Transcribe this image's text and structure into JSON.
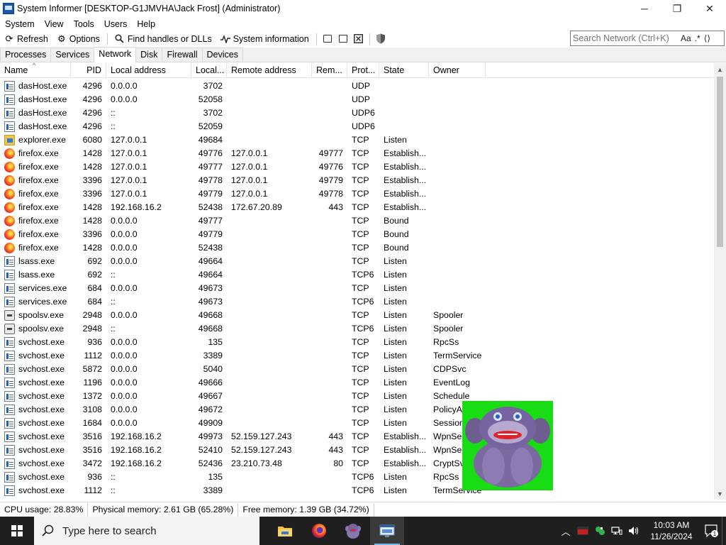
{
  "window": {
    "title": "System Informer [DESKTOP-G1JMVHA\\Jack Frost] (Administrator)",
    "minimize_glyph": "─",
    "maximize_glyph": "❐",
    "close_glyph": "✕"
  },
  "menu": [
    "System",
    "View",
    "Tools",
    "Users",
    "Help"
  ],
  "toolbar": {
    "refresh_label": "Refresh",
    "options_label": "Options",
    "find_label": "Find handles or DLLs",
    "sysinfo_label": "System information"
  },
  "search": {
    "placeholder": "Search Network (Ctrl+K)",
    "case_label": "Aa",
    "regex_label": ".*"
  },
  "tabs": [
    "Processes",
    "Services",
    "Network",
    "Disk",
    "Firewall",
    "Devices"
  ],
  "active_tab": "Network",
  "columns": [
    "Name",
    "PID",
    "Local address",
    "Local...",
    "Remote address",
    "Rem...",
    "Prot...",
    "State",
    "Owner"
  ],
  "rows": [
    {
      "icon": "host-icon",
      "name": "dasHost.exe",
      "pid": "4296",
      "laddr": "0.0.0.0",
      "lport": "3702",
      "raddr": "",
      "rport": "",
      "proto": "UDP",
      "state": "",
      "owner": ""
    },
    {
      "icon": "host-icon",
      "name": "dasHost.exe",
      "pid": "4296",
      "laddr": "0.0.0.0",
      "lport": "52058",
      "raddr": "",
      "rport": "",
      "proto": "UDP",
      "state": "",
      "owner": ""
    },
    {
      "icon": "host-icon",
      "name": "dasHost.exe",
      "pid": "4296",
      "laddr": "::",
      "lport": "3702",
      "raddr": "",
      "rport": "",
      "proto": "UDP6",
      "state": "",
      "owner": ""
    },
    {
      "icon": "host-icon",
      "name": "dasHost.exe",
      "pid": "4296",
      "laddr": "::",
      "lport": "52059",
      "raddr": "",
      "rport": "",
      "proto": "UDP6",
      "state": "",
      "owner": ""
    },
    {
      "icon": "explorer-icon",
      "name": "explorer.exe",
      "pid": "6080",
      "laddr": "127.0.0.1",
      "lport": "49684",
      "raddr": "",
      "rport": "",
      "proto": "TCP",
      "state": "Listen",
      "owner": ""
    },
    {
      "icon": "firefox-icon",
      "name": "firefox.exe",
      "pid": "1428",
      "laddr": "127.0.0.1",
      "lport": "49776",
      "raddr": "127.0.0.1",
      "rport": "49777",
      "proto": "TCP",
      "state": "Establish...",
      "owner": ""
    },
    {
      "icon": "firefox-icon",
      "name": "firefox.exe",
      "pid": "1428",
      "laddr": "127.0.0.1",
      "lport": "49777",
      "raddr": "127.0.0.1",
      "rport": "49776",
      "proto": "TCP",
      "state": "Establish...",
      "owner": ""
    },
    {
      "icon": "firefox-icon",
      "name": "firefox.exe",
      "pid": "3396",
      "laddr": "127.0.0.1",
      "lport": "49778",
      "raddr": "127.0.0.1",
      "rport": "49779",
      "proto": "TCP",
      "state": "Establish...",
      "owner": ""
    },
    {
      "icon": "firefox-icon",
      "name": "firefox.exe",
      "pid": "3396",
      "laddr": "127.0.0.1",
      "lport": "49779",
      "raddr": "127.0.0.1",
      "rport": "49778",
      "proto": "TCP",
      "state": "Establish...",
      "owner": ""
    },
    {
      "icon": "firefox-icon",
      "name": "firefox.exe",
      "pid": "1428",
      "laddr": "192.168.16.2",
      "lport": "52438",
      "raddr": "172.67.20.89",
      "rport": "443",
      "proto": "TCP",
      "state": "Establish...",
      "owner": ""
    },
    {
      "icon": "firefox-icon",
      "name": "firefox.exe",
      "pid": "1428",
      "laddr": "0.0.0.0",
      "lport": "49777",
      "raddr": "",
      "rport": "",
      "proto": "TCP",
      "state": "Bound",
      "owner": ""
    },
    {
      "icon": "firefox-icon",
      "name": "firefox.exe",
      "pid": "3396",
      "laddr": "0.0.0.0",
      "lport": "49779",
      "raddr": "",
      "rport": "",
      "proto": "TCP",
      "state": "Bound",
      "owner": ""
    },
    {
      "icon": "firefox-icon",
      "name": "firefox.exe",
      "pid": "1428",
      "laddr": "0.0.0.0",
      "lport": "52438",
      "raddr": "",
      "rport": "",
      "proto": "TCP",
      "state": "Bound",
      "owner": ""
    },
    {
      "icon": "host-icon",
      "name": "lsass.exe",
      "pid": "692",
      "laddr": "0.0.0.0",
      "lport": "49664",
      "raddr": "",
      "rport": "",
      "proto": "TCP",
      "state": "Listen",
      "owner": ""
    },
    {
      "icon": "host-icon",
      "name": "lsass.exe",
      "pid": "692",
      "laddr": "::",
      "lport": "49664",
      "raddr": "",
      "rport": "",
      "proto": "TCP6",
      "state": "Listen",
      "owner": ""
    },
    {
      "icon": "host-icon",
      "name": "services.exe",
      "pid": "684",
      "laddr": "0.0.0.0",
      "lport": "49673",
      "raddr": "",
      "rport": "",
      "proto": "TCP",
      "state": "Listen",
      "owner": ""
    },
    {
      "icon": "host-icon",
      "name": "services.exe",
      "pid": "684",
      "laddr": "::",
      "lport": "49673",
      "raddr": "",
      "rport": "",
      "proto": "TCP6",
      "state": "Listen",
      "owner": ""
    },
    {
      "icon": "printer-icon",
      "name": "spoolsv.exe",
      "pid": "2948",
      "laddr": "0.0.0.0",
      "lport": "49668",
      "raddr": "",
      "rport": "",
      "proto": "TCP",
      "state": "Listen",
      "owner": "Spooler"
    },
    {
      "icon": "printer-icon",
      "name": "spoolsv.exe",
      "pid": "2948",
      "laddr": "::",
      "lport": "49668",
      "raddr": "",
      "rport": "",
      "proto": "TCP6",
      "state": "Listen",
      "owner": "Spooler"
    },
    {
      "icon": "host-icon",
      "name": "svchost.exe",
      "pid": "936",
      "laddr": "0.0.0.0",
      "lport": "135",
      "raddr": "",
      "rport": "",
      "proto": "TCP",
      "state": "Listen",
      "owner": "RpcSs"
    },
    {
      "icon": "host-icon",
      "name": "svchost.exe",
      "pid": "1112",
      "laddr": "0.0.0.0",
      "lport": "3389",
      "raddr": "",
      "rport": "",
      "proto": "TCP",
      "state": "Listen",
      "owner": "TermService"
    },
    {
      "icon": "host-icon",
      "name": "svchost.exe",
      "pid": "5872",
      "laddr": "0.0.0.0",
      "lport": "5040",
      "raddr": "",
      "rport": "",
      "proto": "TCP",
      "state": "Listen",
      "owner": "CDPSvc"
    },
    {
      "icon": "host-icon",
      "name": "svchost.exe",
      "pid": "1196",
      "laddr": "0.0.0.0",
      "lport": "49666",
      "raddr": "",
      "rport": "",
      "proto": "TCP",
      "state": "Listen",
      "owner": "EventLog"
    },
    {
      "icon": "host-icon",
      "name": "svchost.exe",
      "pid": "1372",
      "laddr": "0.0.0.0",
      "lport": "49667",
      "raddr": "",
      "rport": "",
      "proto": "TCP",
      "state": "Listen",
      "owner": "Schedule"
    },
    {
      "icon": "host-icon",
      "name": "svchost.exe",
      "pid": "3108",
      "laddr": "0.0.0.0",
      "lport": "49672",
      "raddr": "",
      "rport": "",
      "proto": "TCP",
      "state": "Listen",
      "owner": "PolicyA"
    },
    {
      "icon": "host-icon",
      "name": "svchost.exe",
      "pid": "1684",
      "laddr": "0.0.0.0",
      "lport": "49909",
      "raddr": "",
      "rport": "",
      "proto": "TCP",
      "state": "Listen",
      "owner": "Session"
    },
    {
      "icon": "host-icon",
      "name": "svchost.exe",
      "pid": "3516",
      "laddr": "192.168.16.2",
      "lport": "49973",
      "raddr": "52.159.127.243",
      "rport": "443",
      "proto": "TCP",
      "state": "Establish...",
      "owner": "WpnSer"
    },
    {
      "icon": "host-icon",
      "name": "svchost.exe",
      "pid": "3516",
      "laddr": "192.168.16.2",
      "lport": "52410",
      "raddr": "52.159.127.243",
      "rport": "443",
      "proto": "TCP",
      "state": "Establish...",
      "owner": "WpnSer"
    },
    {
      "icon": "host-icon",
      "name": "svchost.exe",
      "pid": "3472",
      "laddr": "192.168.16.2",
      "lport": "52436",
      "raddr": "23.210.73.48",
      "rport": "80",
      "proto": "TCP",
      "state": "Establish...",
      "owner": "CryptSv"
    },
    {
      "icon": "host-icon",
      "name": "svchost.exe",
      "pid": "936",
      "laddr": "::",
      "lport": "135",
      "raddr": "",
      "rport": "",
      "proto": "TCP6",
      "state": "Listen",
      "owner": "RpcSs"
    },
    {
      "icon": "host-icon",
      "name": "svchost.exe",
      "pid": "1112",
      "laddr": "::",
      "lport": "3389",
      "raddr": "",
      "rport": "",
      "proto": "TCP6",
      "state": "Listen",
      "owner": "TermService"
    }
  ],
  "status": {
    "cpu": "CPU usage: 28.83%",
    "physical": "Physical memory: 2.61 GB (65.28%)",
    "free": "Free memory: 1.39 GB (34.72%)"
  },
  "taskbar": {
    "search_placeholder": "Type here to search",
    "time": "10:03 AM",
    "date": "11/26/2024",
    "notification_count": "1",
    "apps": [
      "file-explorer-icon",
      "firefox-icon",
      "bonzi-icon",
      "system-informer-icon"
    ]
  }
}
